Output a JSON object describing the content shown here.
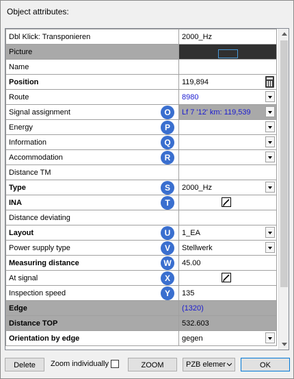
{
  "dialog": {
    "title": "Object attributes:"
  },
  "rows": [
    {
      "name": "Dbl Klick: Transponieren",
      "value": "2000_Hz",
      "bold": false
    },
    {
      "name": "Picture",
      "value": "",
      "bold": false
    },
    {
      "name": "Name",
      "value": "",
      "bold": false
    },
    {
      "name": "Position",
      "value": "119,894",
      "bold": true
    },
    {
      "name": "Route",
      "value": "8980",
      "bold": false
    },
    {
      "name": "Signal assignment",
      "value": "Lf 7 '12' km: 119,539",
      "bold": false,
      "badge": "O"
    },
    {
      "name": "Energy",
      "value": "",
      "bold": false,
      "badge": "P"
    },
    {
      "name": "Information",
      "value": "",
      "bold": false,
      "badge": "Q"
    },
    {
      "name": "Accommodation",
      "value": "",
      "bold": false,
      "badge": "R"
    },
    {
      "name": "Distance TM",
      "value": "",
      "bold": false
    },
    {
      "name": "Type",
      "value": "2000_Hz",
      "bold": true,
      "badge": "S"
    },
    {
      "name": "INA",
      "value": "",
      "bold": true,
      "badge": "T"
    },
    {
      "name": "Distance deviating",
      "value": "",
      "bold": false
    },
    {
      "name": "Layout",
      "value": "1_EA",
      "bold": true,
      "badge": "U"
    },
    {
      "name": "Power supply type",
      "value": "Stellwerk",
      "bold": false,
      "badge": "V"
    },
    {
      "name": "Measuring distance",
      "value": "45.00",
      "bold": true,
      "badge": "W"
    },
    {
      "name": "At signal",
      "value": "",
      "bold": false,
      "badge": "X"
    },
    {
      "name": "Inspection speed",
      "value": "135",
      "bold": false,
      "badge": "Y"
    },
    {
      "name": "Edge",
      "value": "(1320)",
      "bold": true
    },
    {
      "name": "Distance TOP",
      "value": "532.603",
      "bold": true
    },
    {
      "name": "Orientation by edge",
      "value": "gegen",
      "bold": true
    }
  ],
  "checkboxes": {
    "ina": true,
    "at_signal": true
  },
  "footer": {
    "delete": "Delete",
    "zoom_individually": "Zoom individually",
    "zoom": "ZOOM",
    "pzb_combo": "PZB elemer",
    "ok": "OK"
  },
  "colors": {
    "badge": "#3a6fcf",
    "grey_row": "#a9a9a9",
    "link_blue": "#1a1ad0",
    "ok_border": "#0078d7"
  }
}
